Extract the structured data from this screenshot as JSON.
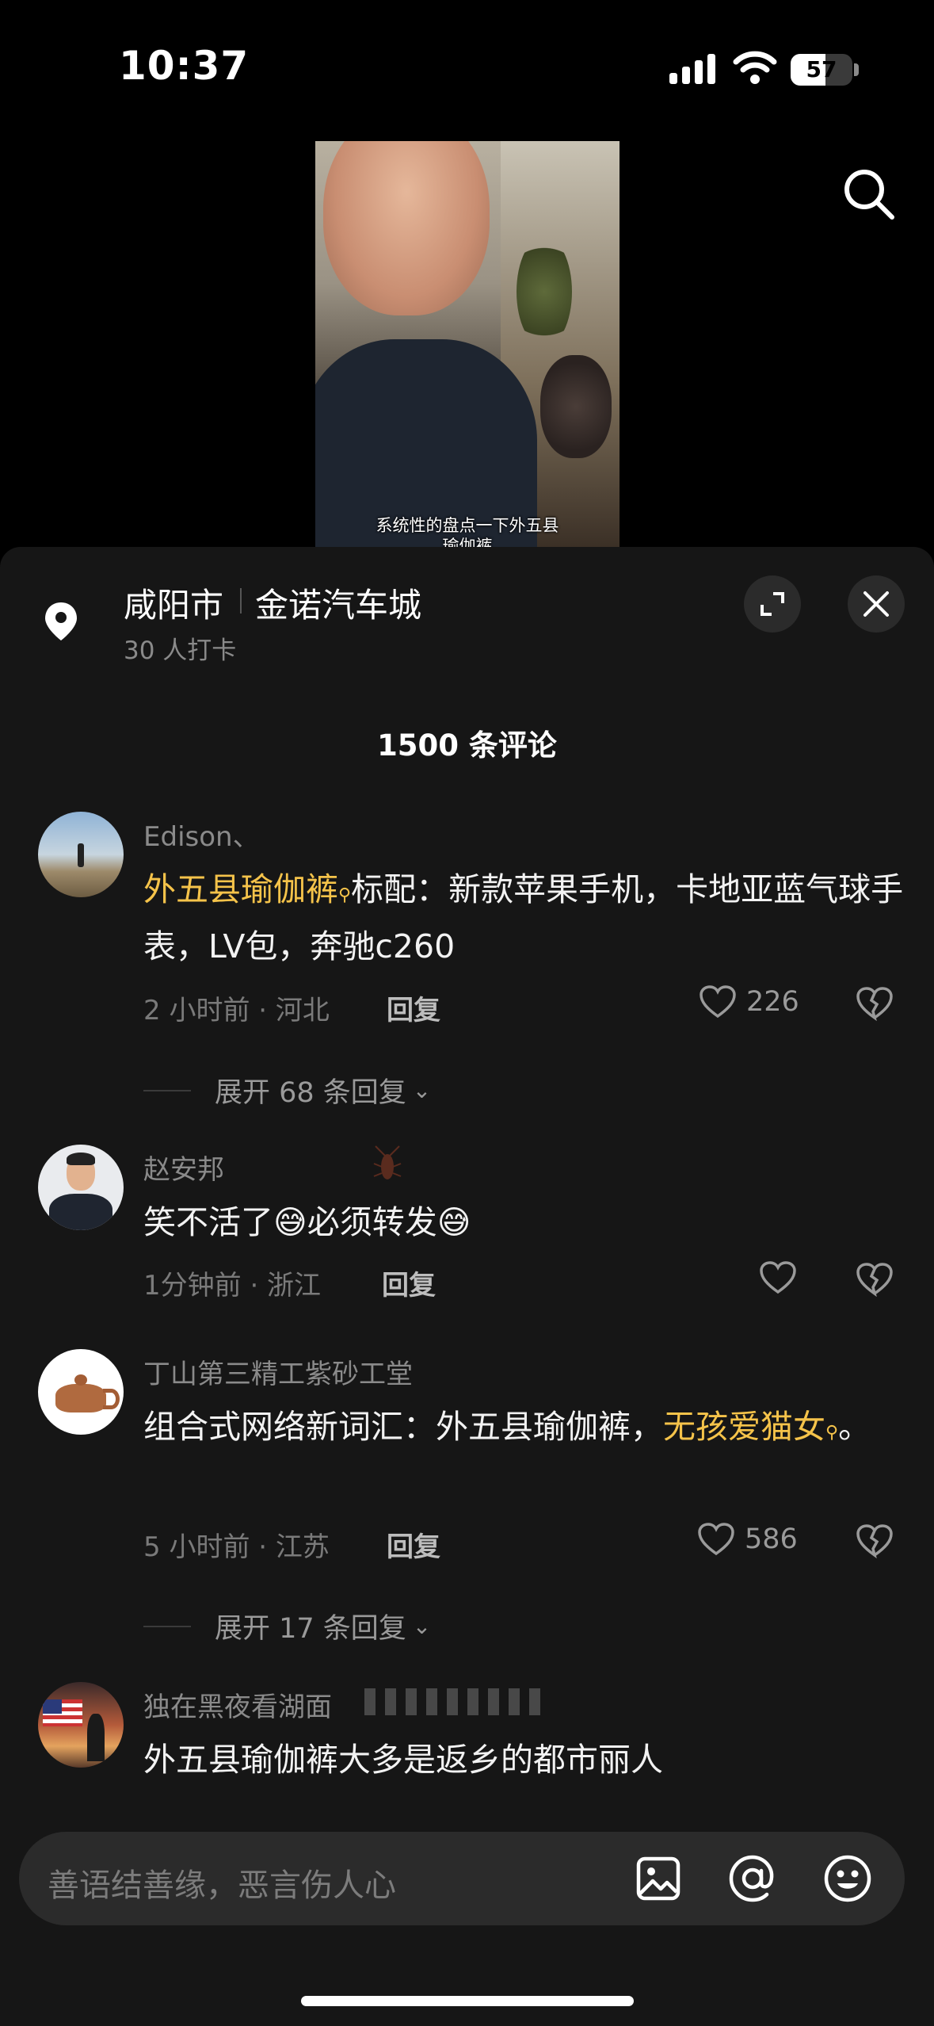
{
  "status_bar": {
    "time": "10:37",
    "battery": "57",
    "battery_level": 0.57
  },
  "video": {
    "caption_line1": "系统性的盘点一下外五县",
    "caption_line2": "瑜伽裤"
  },
  "location": {
    "city": "咸阳市",
    "place": "金诺汽车城",
    "checkins": "30 人打卡"
  },
  "comments_title": "1500 条评论",
  "comments": [
    {
      "username": "Edison、",
      "text_highlight": "外五县瑜伽裤",
      "text": "标配：新款苹果手机，卡地亚蓝气球手表，LV包，奔驰c260",
      "meta": "2 小时前 · 河北",
      "reply": "回复",
      "likes": "226",
      "expand_replies": "展开 68 条回复"
    },
    {
      "username": "赵安邦",
      "text": "笑不活了😅必须转发😅",
      "meta": "1分钟前 · 浙江",
      "reply": "回复",
      "likes": ""
    },
    {
      "username": "丁山第三精工紫砂工堂",
      "text": "组合式网络新词汇：外五县瑜伽裤，",
      "text_highlight": "无孩爱猫女",
      "text_end": "。",
      "meta": "5 小时前 · 江苏",
      "reply": "回复",
      "likes": "586",
      "expand_replies": "展开 17 条回复"
    },
    {
      "username": "独在黑夜看湖面",
      "text": "外五县瑜伽裤大多是返乡的都市丽人"
    }
  ],
  "input": {
    "placeholder": "善语结善缘，恶言伤人心"
  },
  "icons": {
    "search": "search-icon",
    "location": "location-pin-icon",
    "expand": "expand-icon",
    "close": "close-icon",
    "heart": "heart-icon",
    "dislike": "broken-heart-icon",
    "image": "image-icon",
    "mention": "at-icon",
    "emoji": "emoji-icon"
  },
  "colors": {
    "highlight": "#f5c34a",
    "sheet_bg": "#161616"
  }
}
